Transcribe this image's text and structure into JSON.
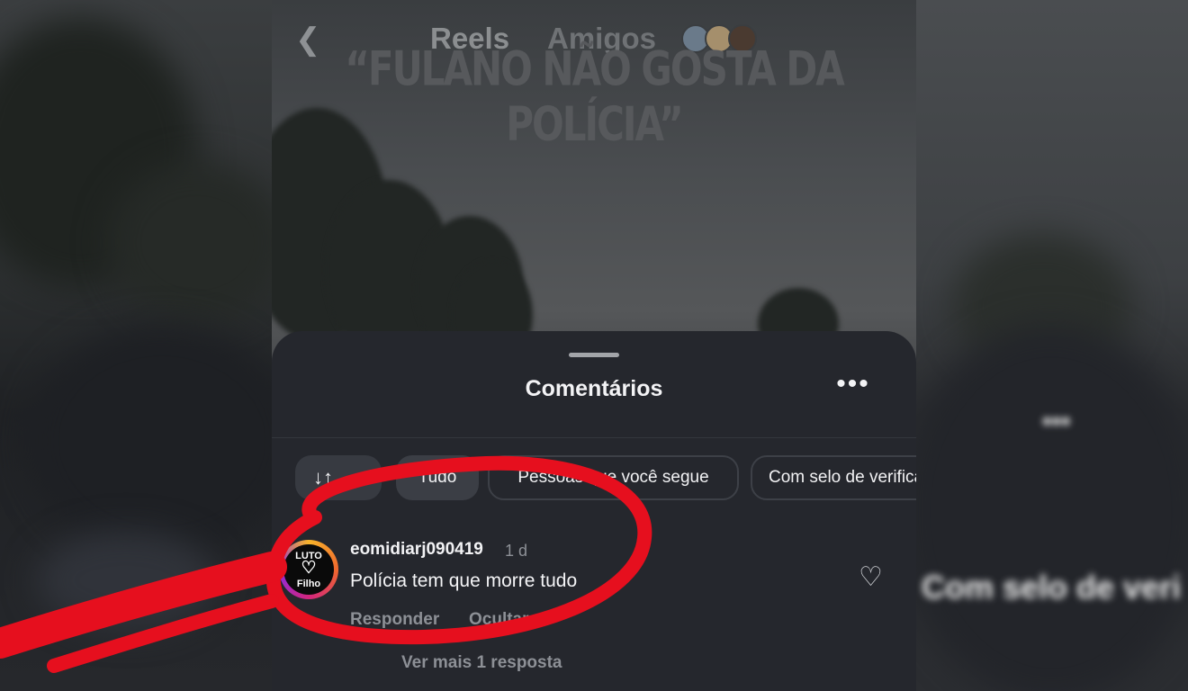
{
  "top_bar": {
    "back_icon": "chevron-left-icon",
    "tab_reels": "Reels",
    "tab_friends": "Amigos",
    "headline": "“FULANO NÃO GOSTA DA POLÍCIA”"
  },
  "comments_sheet": {
    "title": "Comentários",
    "more_icon": "•••",
    "filters": {
      "sort_icon": "↓↑",
      "sort_label": "",
      "all_label": "Tudo",
      "following_label": "Pessoas que você segue",
      "verified_label": "Com selo de verificação"
    },
    "comment": {
      "avatar_text_top": "LUTO",
      "avatar_icon": "♡",
      "avatar_text_bottom": "Filho",
      "username": "eomidiarj090419",
      "time": "1 d",
      "text": "Polícia tem que morre tudo",
      "reply_label": "Responder",
      "hide_label": "Ocultar",
      "like_icon": "♡",
      "view_replies": "Ver mais 1 resposta"
    }
  },
  "background_blur": {
    "right_chip_text": "Com selo de veri"
  },
  "colors": {
    "sheet_background": "#25272d",
    "annotation_red": "#e60f1e",
    "text_primary": "#f2f2f4",
    "text_secondary": "#8d9096"
  }
}
